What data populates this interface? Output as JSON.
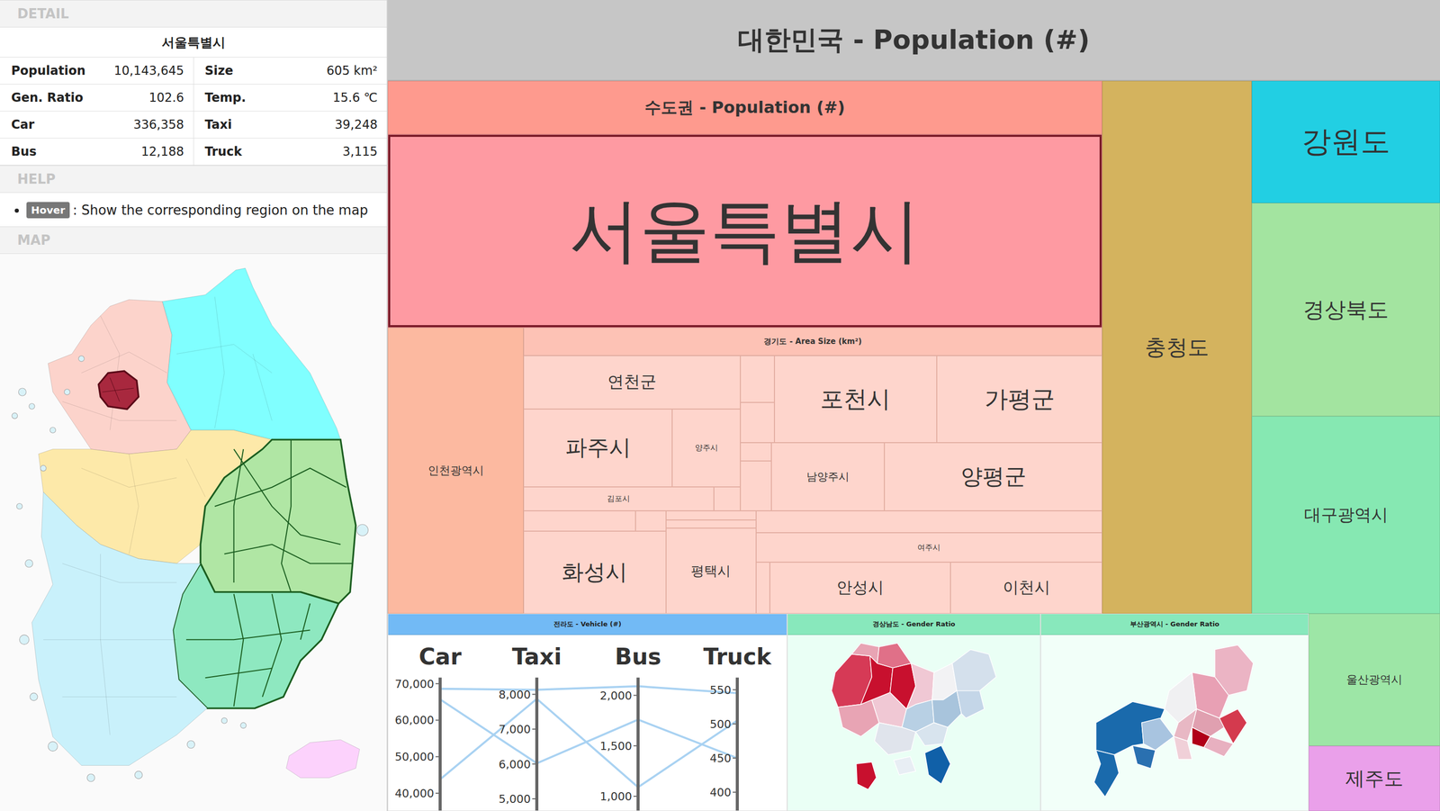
{
  "detail": {
    "header": "DETAIL",
    "title": "서울특별시",
    "rows": [
      [
        {
          "label": "Population",
          "value": "10,143,645"
        },
        {
          "label": "Size",
          "value": "605 km²"
        }
      ],
      [
        {
          "label": "Gen. Ratio",
          "value": "102.6"
        },
        {
          "label": "Temp.",
          "value": "15.6 ℃"
        }
      ],
      [
        {
          "label": "Car",
          "value": "336,358"
        },
        {
          "label": "Taxi",
          "value": "39,248"
        }
      ],
      [
        {
          "label": "Bus",
          "value": "12,188"
        },
        {
          "label": "Truck",
          "value": "3,115"
        }
      ]
    ]
  },
  "help": {
    "header": "HELP",
    "items": [
      {
        "badge": "Hover",
        "text": ": Show the corresponding region on the map"
      }
    ]
  },
  "map": {
    "header": "MAP",
    "regions": [
      {
        "color": "#fcd3cb",
        "selected": false,
        "highlighted": false
      },
      {
        "color": "#a8283e",
        "selected": true,
        "highlighted": false
      },
      {
        "color": "#80ffff",
        "selected": false,
        "highlighted": false
      },
      {
        "color": "#fde9a9",
        "selected": false,
        "highlighted": false
      },
      {
        "color": "#b0e6a4",
        "selected": false,
        "highlighted": true
      },
      {
        "color": "#8ee8c0",
        "selected": false,
        "highlighted": true
      },
      {
        "color": "#c9f1fb",
        "selected": false,
        "highlighted": false
      },
      {
        "color": "#fcd2fc",
        "selected": false,
        "highlighted": false
      }
    ]
  },
  "treemap": {
    "title": "대한민국 - Population (#)",
    "capital": {
      "header": "수도권 - Population (#)",
      "color": "#fe9a8e",
      "seoul": {
        "label": "서울특별시",
        "selected": true,
        "color": "#fe9aa2"
      },
      "incheon": {
        "label": "인천광역시",
        "color": "#fcb9a0"
      },
      "gyeonggi": {
        "header": "경기도 - Area Size (km²)",
        "color": "#fed5cc",
        "cells": [
          {
            "label": "연천군"
          },
          {
            "label": "파주시"
          },
          {
            "label": "양주시"
          },
          {
            "label": "김포시"
          },
          {
            "label": "화성시"
          },
          {
            "label": "평택시"
          },
          {
            "label": "포천시"
          },
          {
            "label": "가평군"
          },
          {
            "label": "남양주시"
          },
          {
            "label": "양평군"
          },
          {
            "label": "여주시"
          },
          {
            "label": "안성시"
          },
          {
            "label": "이천시"
          }
        ]
      }
    },
    "provinces": [
      {
        "label": "충청도",
        "color": "#d4b35e"
      },
      {
        "label": "강원도",
        "color": "#22cfe3"
      },
      {
        "label": "경상북도",
        "color": "#a3e4a0"
      },
      {
        "label": "대구광역시",
        "color": "#86e8b2"
      },
      {
        "label": "울산광역시",
        "color": "#9de6a6"
      },
      {
        "label": "제주도",
        "color": "#eaa0ea"
      }
    ],
    "jeolla": {
      "header": "전라도 - Vehicle (#)",
      "color": "#72baf5",
      "axes": [
        {
          "label": "Car",
          "ticks": [
            "70,000",
            "60,000",
            "50,000",
            "40,000"
          ]
        },
        {
          "label": "Taxi",
          "ticks": [
            "8,000",
            "7,000",
            "6,000",
            "5,000"
          ]
        },
        {
          "label": "Bus",
          "ticks": [
            "2,000",
            "1,500",
            "1,000"
          ]
        },
        {
          "label": "Truck",
          "ticks": [
            "550",
            "500",
            "450",
            "400"
          ]
        }
      ],
      "series": [
        {
          "values": [
            68600,
            8130,
            2090,
            545
          ]
        },
        {
          "values": [
            65700,
            6020,
            1760,
            450
          ]
        },
        {
          "values": [
            43800,
            7870,
            1090,
            505
          ]
        }
      ]
    },
    "gyeongnam": {
      "header": "경상남도 - Gender Ratio",
      "color": "#88e8bc",
      "regions": [
        {
          "color": "#d63a56"
        },
        {
          "color": "#e8a4b4"
        },
        {
          "color": "#c8102e"
        },
        {
          "color": "#c8102e"
        },
        {
          "color": "#e07088"
        },
        {
          "color": "#f0c8d4"
        },
        {
          "color": "#f2f2f4"
        },
        {
          "color": "#d4e0ec"
        },
        {
          "color": "#e8a4b4"
        },
        {
          "color": "#f0c8d4"
        },
        {
          "color": "#b8d0e4"
        },
        {
          "color": "#a8c4dc"
        },
        {
          "color": "#c4d6e8"
        },
        {
          "color": "#e0e4ec"
        },
        {
          "color": "#c8102e"
        },
        {
          "color": "#1060a8"
        },
        {
          "color": "#d8e4ee"
        },
        {
          "color": "#e8eef4"
        }
      ]
    },
    "busan": {
      "header": "부산광역시 - Gender Ratio",
      "color": "#88e8bc",
      "regions": [
        {
          "color": "#ebb4c4"
        },
        {
          "color": "#e8a0b4"
        },
        {
          "color": "#f0f0f2"
        },
        {
          "color": "#e0a0b0"
        },
        {
          "color": "#d43a4e"
        },
        {
          "color": "#e8b8c4"
        },
        {
          "color": "#1a6aac"
        },
        {
          "color": "#a8c4e0"
        },
        {
          "color": "#f0d0d8"
        },
        {
          "color": "#b00018"
        },
        {
          "color": "#e8b0c0"
        },
        {
          "color": "#1a6aac"
        },
        {
          "color": "#2a70b0"
        }
      ]
    }
  }
}
